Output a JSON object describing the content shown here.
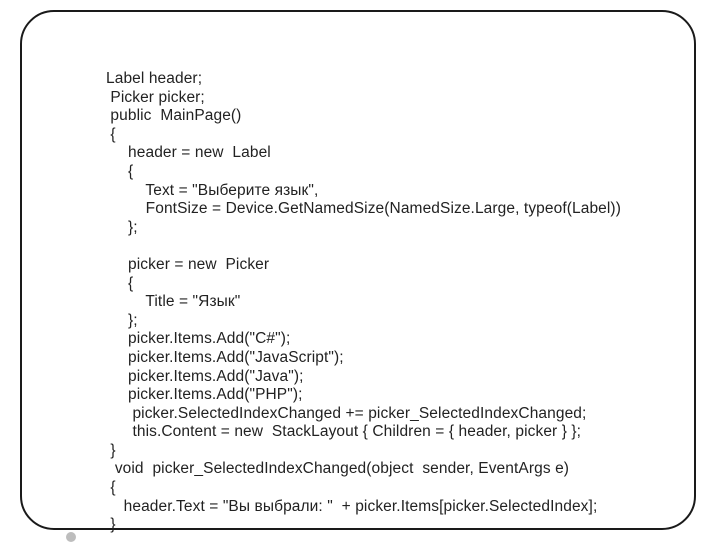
{
  "code": {
    "lines": [
      "Label header;",
      " Picker picker;",
      " public  MainPage()",
      " {",
      "     header = new  Label",
      "     {",
      "         Text = \"Выберите язык\",",
      "         FontSize = Device.GetNamedSize(NamedSize.Large, typeof(Label))",
      "     };",
      "",
      "     picker = new  Picker",
      "     {",
      "         Title = \"Язык\"",
      "     };",
      "     picker.Items.Add(\"C#\");",
      "     picker.Items.Add(\"JavaScript\");",
      "     picker.Items.Add(\"Java\");",
      "     picker.Items.Add(\"PHP\");",
      "      picker.SelectedIndexChanged += picker_SelectedIndexChanged;",
      "      this.Content = new  StackLayout { Children = { header, picker } };",
      " }",
      "  void  picker_SelectedIndexChanged(object  sender, EventArgs e)",
      " {",
      "    header.Text = \"Вы выбрали: \"  + picker.Items[picker.SelectedIndex];",
      " }"
    ]
  }
}
